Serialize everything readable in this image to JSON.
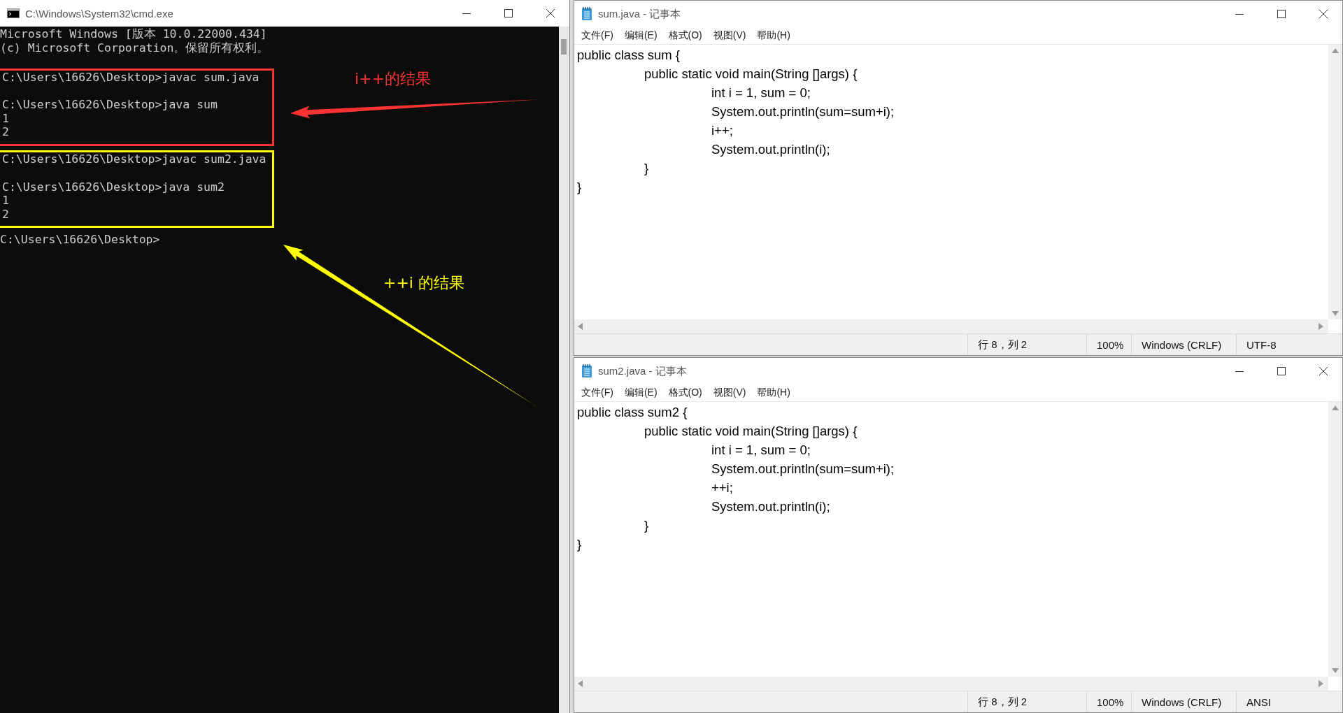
{
  "console_window": {
    "title": "C:\\Windows\\System32\\cmd.exe",
    "blocks": [
      {
        "lines": [
          {
            "text": "Microsoft Windows [版本 10.0.22000.434]",
            "blank_after": false
          },
          {
            "text": "(c) Microsoft Corporation。保留所有权利。",
            "blank_after": true
          }
        ]
      },
      {
        "color": "#ff3333",
        "lines": [
          {
            "text": "C:\\Users\\16626\\Desktop>javac sum.java",
            "blank_after": true
          },
          {
            "text": "C:\\Users\\16626\\Desktop>java sum",
            "blank_after": false
          },
          {
            "text": "1",
            "blank_after": false
          },
          {
            "text": "2",
            "blank_after": true
          }
        ]
      },
      {
        "color": "#ffff00",
        "lines": [
          {
            "text": "C:\\Users\\16626\\Desktop>javac sum2.java",
            "blank_after": true
          },
          {
            "text": "C:\\Users\\16626\\Desktop>java sum2",
            "blank_after": false
          },
          {
            "text": "1",
            "blank_after": false
          },
          {
            "text": "2",
            "blank_after": true
          }
        ]
      },
      {
        "lines": [
          {
            "text": "C:\\Users\\16626\\Desktop>",
            "blank_after": false
          }
        ]
      }
    ],
    "annotations": [
      {
        "kind": "label",
        "text": "i++的结果",
        "color": "#ff3333"
      },
      {
        "kind": "arrow",
        "color": "#ff3333"
      },
      {
        "kind": "label",
        "text": "++i 的结果",
        "color": "#ffff00"
      },
      {
        "kind": "arrow",
        "color": "#ffff00"
      }
    ]
  },
  "editor_windows": [
    {
      "title": "sum.java - 记事本",
      "menu": [
        "文件(F)",
        "编辑(E)",
        "格式(O)",
        "视图(V)",
        "帮助(H)"
      ],
      "code_lines": [
        "public class sum {",
        "\tpublic static void main(String []args) {",
        "\t\tint i = 1, sum = 0;",
        "\t\tSystem.out.println(sum=sum+i);",
        "\t\ti++;",
        "\t\tSystem.out.println(i);",
        "\t}",
        "}"
      ],
      "status_bar": {
        "position": "行 8，列 2",
        "zoom": "100%",
        "line_ending": "Windows (CRLF)",
        "encoding": "UTF-8"
      }
    },
    {
      "title": "sum2.java - 记事本",
      "menu": [
        "文件(F)",
        "编辑(E)",
        "格式(O)",
        "视图(V)",
        "帮助(H)"
      ],
      "code_lines": [
        "public class sum2 {",
        "\tpublic static void main(String []args) {",
        "\t\tint i = 1, sum = 0;",
        "\t\tSystem.out.println(sum=sum+i);",
        "\t\t++i;",
        "\t\tSystem.out.println(i);",
        "\t}",
        "}"
      ],
      "status_bar": {
        "position": "行 8，列 2",
        "zoom": "100%",
        "line_ending": "Windows (CRLF)",
        "encoding": "ANSI"
      }
    }
  ]
}
